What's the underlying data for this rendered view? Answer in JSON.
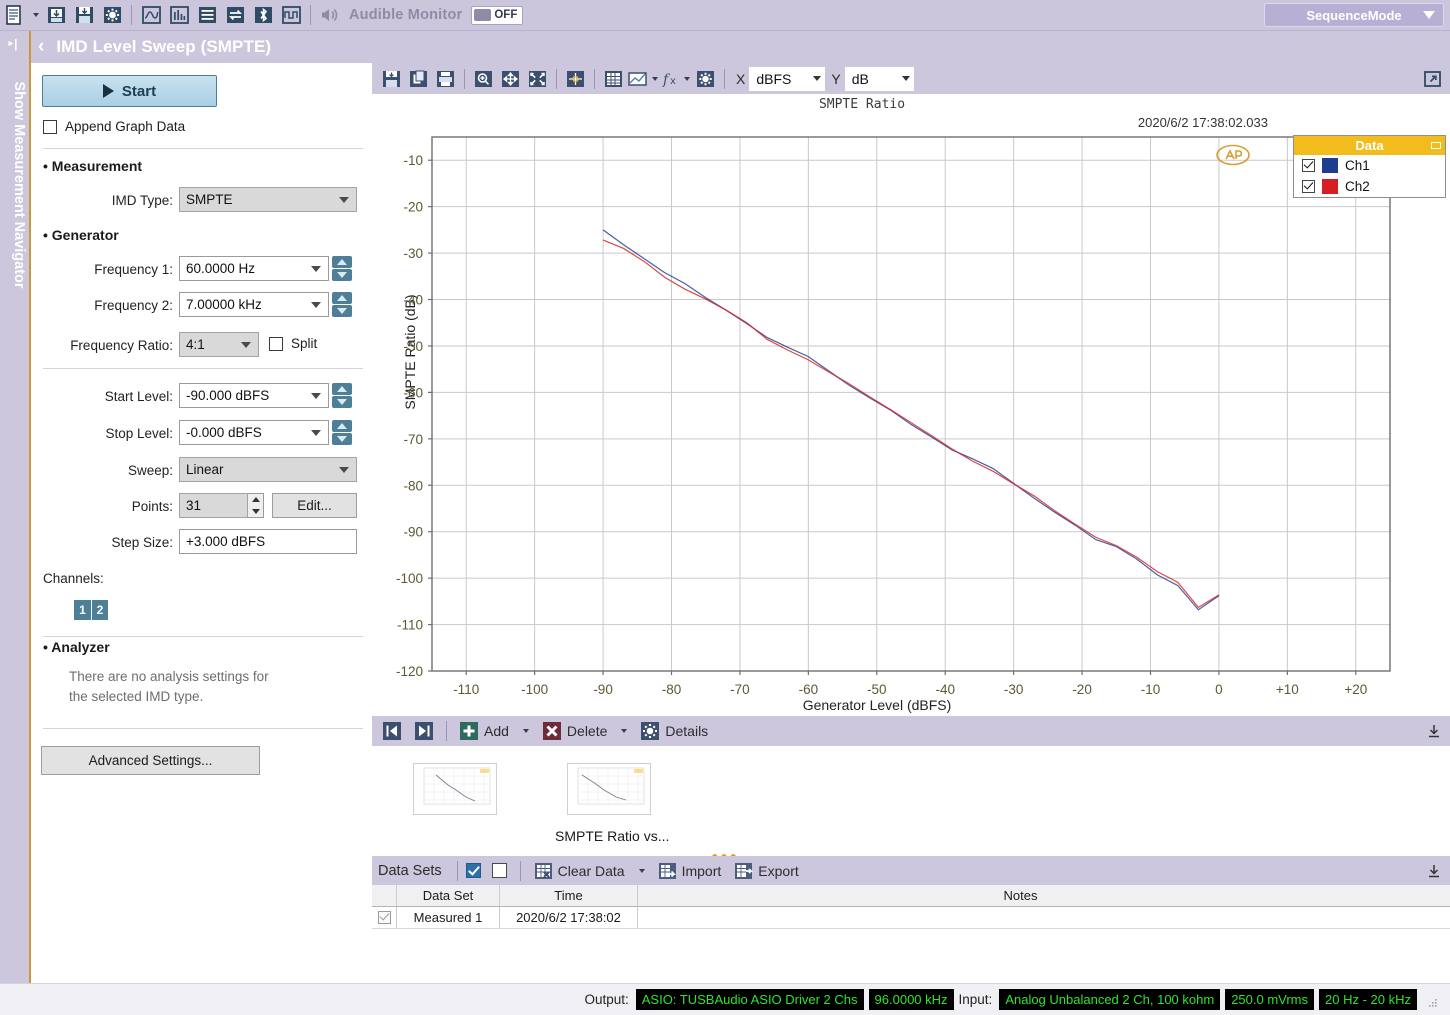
{
  "topbar": {
    "icons": [
      "new-document-icon",
      "dropdown-caret-icon",
      "open-file-icon",
      "save-icon",
      "settings-gear-icon",
      "waveform-icon",
      "bargraph-icon",
      "list-icon",
      "transfer-icon",
      "bluetooth-icon",
      "square-wave-icon"
    ],
    "audible_monitor_label": "Audible Monitor",
    "monitor_state": "OFF",
    "sequence_mode_label": "SequenceMode"
  },
  "titlebar": {
    "title": "IMD Level Sweep (SMPTE)",
    "back_glyph": "‹"
  },
  "vertical_strip": {
    "label": "Show Measurement Navigator",
    "pin_glyph": "‣|"
  },
  "left_panel": {
    "start_label": "Start",
    "append_graph_data_label": "Append Graph Data",
    "append_graph_data_checked": false,
    "measurement_heading": "Measurement",
    "imd_type_label": "IMD Type:",
    "imd_type_value": "SMPTE",
    "generator_heading": "Generator",
    "frequency1_label": "Frequency 1:",
    "frequency1_value": "60.0000 Hz",
    "frequency2_label": "Frequency 2:",
    "frequency2_value": "7.00000 kHz",
    "frequency_ratio_label": "Frequency Ratio:",
    "frequency_ratio_value": "4:1",
    "split_label": "Split",
    "split_checked": false,
    "start_level_label": "Start Level:",
    "start_level_value": "-90.000 dBFS",
    "stop_level_label": "Stop Level:",
    "stop_level_value": "-0.000 dBFS",
    "sweep_label": "Sweep:",
    "sweep_value": "Linear",
    "points_label": "Points:",
    "points_value": "31",
    "edit_label": "Edit...",
    "step_size_label": "Step Size:",
    "step_size_value": "+3.000 dBFS",
    "channels_label": "Channels:",
    "channel_buttons": [
      "1",
      "2"
    ],
    "analyzer_heading": "Analyzer",
    "analyzer_note_line1": "There are no analysis settings for",
    "analyzer_note_line2": "the selected IMD type.",
    "advanced_settings_label": "Advanced Settings..."
  },
  "graph_toolbar": {
    "icons": [
      "save-graph-icon",
      "copy-graph-icon",
      "print-icon",
      "zoom-icon",
      "pan-icon",
      "fit-icon",
      "cursor-icon",
      "table-icon",
      "graph-style-icon",
      "function-icon",
      "graph-settings-icon"
    ],
    "x_label": "X",
    "x_unit": "dBFS",
    "y_label": "Y",
    "y_unit": "dB",
    "popout_icon": "popout-icon"
  },
  "graph": {
    "header_title": "SMPTE Ratio",
    "timestamp": "2020/6/2 17:38:02.033",
    "watermark": "ap-logo-watermark",
    "legend": {
      "header": "Data",
      "rows": [
        {
          "name": "Ch1",
          "color": "#1f3d8f",
          "checked": true
        },
        {
          "name": "Ch2",
          "color": "#d42020",
          "checked": true
        }
      ]
    }
  },
  "chart_data": {
    "type": "line",
    "title": "SMPTE Ratio",
    "xlabel": "Generator Level (dBFS)",
    "ylabel": "SMPTE Ratio (dB)",
    "xlim": [
      -115,
      25
    ],
    "ylim": [
      -120,
      -5
    ],
    "xticks": [
      "-110",
      "-100",
      "-90",
      "-80",
      "-70",
      "-60",
      "-50",
      "-40",
      "-30",
      "-20",
      "-10",
      "0",
      "+10",
      "+20"
    ],
    "xtick_values": [
      -110,
      -100,
      -90,
      -80,
      -70,
      -60,
      -50,
      -40,
      -30,
      -20,
      -10,
      0,
      10,
      20
    ],
    "yticks": [
      "-10",
      "-20",
      "-30",
      "-40",
      "-50",
      "-60",
      "-70",
      "-80",
      "-90",
      "-100",
      "-110",
      "-120"
    ],
    "ytick_values": [
      -10,
      -20,
      -30,
      -40,
      -50,
      -60,
      -70,
      -80,
      -90,
      -100,
      -110,
      -120
    ],
    "grid": true,
    "legend_position": "top-right",
    "x": [
      -90,
      -87,
      -84,
      -81,
      -78,
      -75,
      -72,
      -69,
      -66,
      -63,
      -60,
      -57,
      -54,
      -51,
      -48,
      -45,
      -42,
      -39,
      -36,
      -33,
      -30,
      -27,
      -24,
      -21,
      -18,
      -15,
      -12,
      -9,
      -6,
      -3,
      0
    ],
    "series": [
      {
        "name": "Ch1",
        "color": "#1f3d8f",
        "values": [
          -25.0,
          -28.2,
          -31.2,
          -34.2,
          -36.6,
          -39.6,
          -42.3,
          -45.2,
          -48.2,
          -50.3,
          -52.3,
          -55.4,
          -58.5,
          -61.2,
          -63.8,
          -66.9,
          -69.6,
          -72.4,
          -74.3,
          -76.4,
          -79.6,
          -82.8,
          -85.8,
          -88.6,
          -91.7,
          -93.2,
          -95.9,
          -99.3,
          -101.6,
          -106.8,
          -103.8
        ]
      },
      {
        "name": "Ch2",
        "color": "#d42020",
        "values": [
          -27.2,
          -29.0,
          -31.8,
          -35.2,
          -37.8,
          -39.9,
          -42.3,
          -45.0,
          -48.6,
          -50.9,
          -53.0,
          -55.6,
          -58.2,
          -61.0,
          -63.7,
          -66.5,
          -69.3,
          -72.2,
          -74.8,
          -77.0,
          -79.7,
          -82.3,
          -85.5,
          -88.4,
          -91.2,
          -93.0,
          -95.5,
          -98.6,
          -100.9,
          -106.3,
          -103.6
        ]
      }
    ]
  },
  "results_toolbar": {
    "prev_label": "prev-result-icon",
    "next_label": "next-result-icon",
    "add_label": "Add",
    "delete_label": "Delete",
    "details_label": "Details",
    "collapse_icon": "collapse-icon"
  },
  "thumbnails": {
    "items": [
      {
        "caption": ""
      },
      {
        "caption": "SMPTE Ratio vs..."
      }
    ]
  },
  "data_sets": {
    "title": "Data Sets",
    "check_all_icon": "check-all-icon",
    "uncheck_all_icon": "uncheck-all-icon",
    "clear_data_label": "Clear Data",
    "import_label": "Import",
    "export_label": "Export",
    "columns": [
      "",
      "Data Set",
      "Time",
      "Notes"
    ],
    "rows": [
      {
        "checked": true,
        "data_set": "Measured 1",
        "time": "2020/6/2 17:38:02",
        "notes": ""
      }
    ]
  },
  "status_bar": {
    "output_label": "Output:",
    "output_device": "ASIO: TUSBAudio ASIO Driver 2 Chs",
    "output_rate": "96.0000 kHz",
    "input_label": "Input:",
    "input_device": "Analog Unbalanced 2 Ch, 100 kohm",
    "input_range": "250.0 mVrms",
    "input_bandwidth": "20 Hz - 20 kHz"
  },
  "colors": {
    "chrome": "#cdc7de",
    "accent_gold": "#c49a3a",
    "legend_header": "#f2bd1c",
    "ch1": "#1f3d8f",
    "ch2": "#d42020",
    "status_green": "#2ce62c"
  }
}
